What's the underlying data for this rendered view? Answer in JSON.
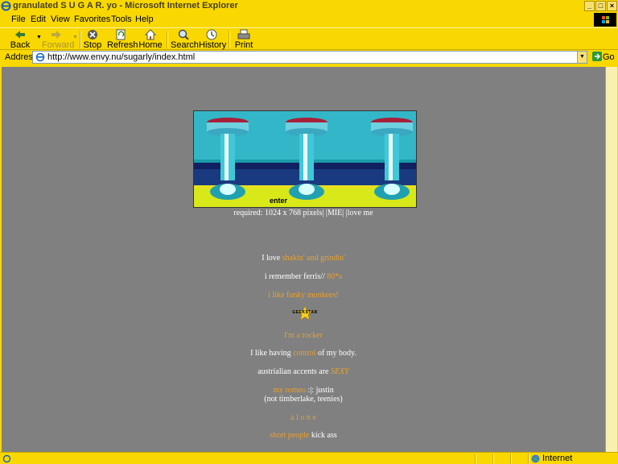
{
  "window": {
    "title": "granulated S U G A R. yo - Microsoft Internet Explorer",
    "min_glyph": "_",
    "max_glyph": "□",
    "close_glyph": "×"
  },
  "menu": [
    "File",
    "Edit",
    "View",
    "Favorites",
    "Tools",
    "Help"
  ],
  "toolbar": {
    "back": "Back",
    "forward": "Forward",
    "stop": "Stop",
    "refresh": "Refresh",
    "home": "Home",
    "search": "Search",
    "history": "History",
    "print": "Print"
  },
  "address": {
    "label": "Address",
    "url": "http://www.envy.nu/sugarly/index.html",
    "go": "Go"
  },
  "page": {
    "enter": "enter",
    "requirement": "required: 1024 x 768 pixels| |MIE| |love me",
    "lines": {
      "l1a": "I love ",
      "l1b": "shakin' and grindin'",
      "l2a": "i remember ferris// ",
      "l2b": "80*s",
      "l3": "i like funky monkees!",
      "badge": "GEEKSTAR",
      "l4": "I'm a rocker",
      "l5a": "I like having ",
      "l5b": "control",
      "l5c": " of my body.",
      "l6a": "austrialian accents are ",
      "l6b": "SEXY",
      "l7a": "my romeo",
      "l7b": " :|: justin",
      "l8": "(not timberlake, teenies)",
      "l9": "a l o n e",
      "l10a": "short people",
      "l10b": " kick ass"
    }
  },
  "status": {
    "zone": "Internet"
  },
  "colors": {
    "chrome": "#f8d800",
    "page_bg": "#808080",
    "link": "#e8a030"
  }
}
